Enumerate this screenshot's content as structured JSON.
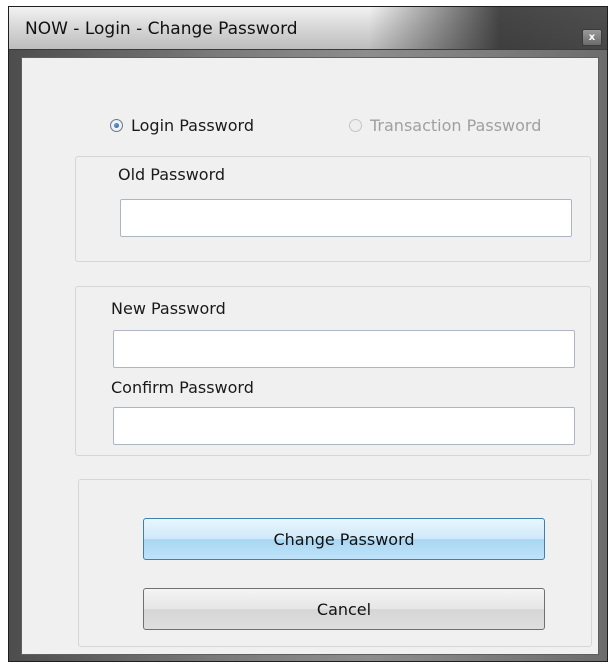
{
  "window": {
    "title": "NOW - Login - Change Password",
    "close_label": "x"
  },
  "password_type": {
    "options": [
      {
        "label": "Login Password",
        "selected": true,
        "enabled": true
      },
      {
        "label": "Transaction Password",
        "selected": false,
        "enabled": false
      }
    ]
  },
  "fields": {
    "old_password": {
      "label": "Old Password",
      "value": ""
    },
    "new_password": {
      "label": "New Password",
      "value": ""
    },
    "confirm_password": {
      "label": "Confirm Password",
      "value": ""
    }
  },
  "buttons": {
    "change_password": "Change Password",
    "cancel": "Cancel"
  },
  "colors": {
    "primary_button": "#bfe2f8",
    "disabled_text": "#a0a0a0",
    "dialog_background": "#f0f0f0"
  }
}
